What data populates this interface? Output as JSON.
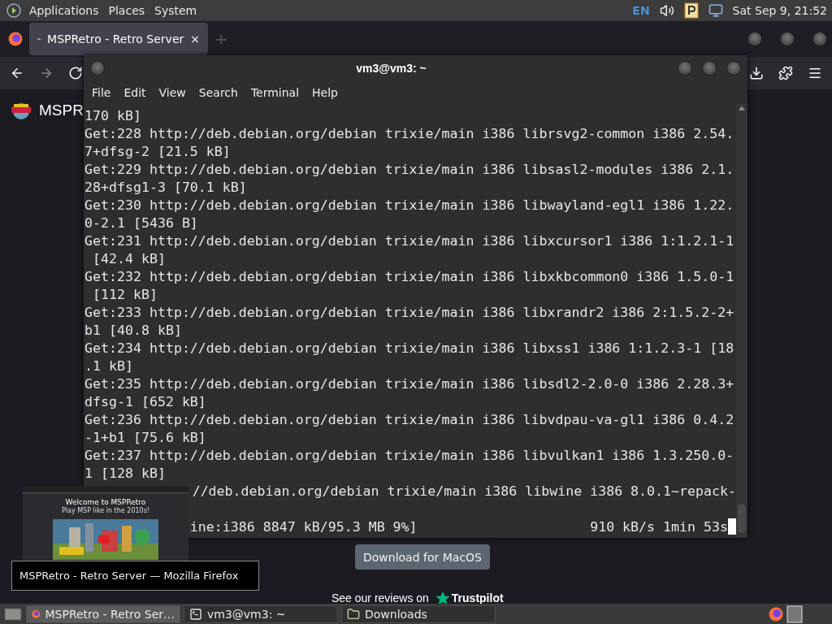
{
  "top_panel": {
    "menus": [
      "Applications",
      "Places",
      "System"
    ],
    "keyboard_layout": "EN",
    "clock": "Sat Sep 9, 21:52"
  },
  "browser": {
    "tab": {
      "title": "MSPRetro - Retro Server",
      "close": "×",
      "selected": true
    },
    "new_tab": "+",
    "site_name": "MSPR",
    "download_button": "Download for MacOS",
    "reviews_text": "See our reviews on",
    "reviews_brand": "Trustpilot"
  },
  "terminal": {
    "title": "vm3@vm3: ~",
    "menu": [
      "File",
      "Edit",
      "View",
      "Search",
      "Terminal",
      "Help"
    ],
    "lines": [
      {
        "kind": "full",
        "text": "170 kB]"
      },
      {
        "kind": "full",
        "text": "Get:228 http://deb.debian.org/debian trixie/main i386 librsvg2-common i386 2.54."
      },
      {
        "kind": "full",
        "text": "7+dfsg-2 [21.5 kB]"
      },
      {
        "kind": "full",
        "text": "Get:229 http://deb.debian.org/debian trixie/main i386 libsasl2-modules i386 2.1."
      },
      {
        "kind": "full",
        "text": "28+dfsg1-3 [70.1 kB]"
      },
      {
        "kind": "full",
        "text": "Get:230 http://deb.debian.org/debian trixie/main i386 libwayland-egl1 i386 1.22."
      },
      {
        "kind": "full",
        "text": "0-2.1 [5436 B]"
      },
      {
        "kind": "full",
        "text": "Get:231 http://deb.debian.org/debian trixie/main i386 libxcursor1 i386 1:1.2.1-1"
      },
      {
        "kind": "full",
        "text": " [42.4 kB]"
      },
      {
        "kind": "full",
        "text": "Get:232 http://deb.debian.org/debian trixie/main i386 libxkbcommon0 i386 1.5.0-1"
      },
      {
        "kind": "full",
        "text": " [112 kB]"
      },
      {
        "kind": "full",
        "text": "Get:233 http://deb.debian.org/debian trixie/main i386 libxrandr2 i386 2:1.5.2-2+"
      },
      {
        "kind": "full",
        "text": "b1 [40.8 kB]"
      },
      {
        "kind": "full",
        "text": "Get:234 http://deb.debian.org/debian trixie/main i386 libxss1 i386 1:1.2.3-1 [18"
      },
      {
        "kind": "full",
        "text": ".1 kB]"
      },
      {
        "kind": "full",
        "text": "Get:235 http://deb.debian.org/debian trixie/main i386 libsdl2-2.0-0 i386 2.28.3+"
      },
      {
        "kind": "full",
        "text": "dfsg-1 [652 kB]"
      },
      {
        "kind": "full",
        "text": "Get:236 http://deb.debian.org/debian trixie/main i386 libvdpau-va-gl1 i386 0.4.2"
      },
      {
        "kind": "full",
        "text": "-1+b1 [75.6 kB]"
      },
      {
        "kind": "full",
        "text": "Get:237 http://deb.debian.org/debian trixie/main i386 libvulkan1 i386 1.3.250.0-"
      },
      {
        "kind": "full",
        "text": "1 [128 kB]"
      },
      {
        "kind": "covered",
        "text": "//deb.debian.org/debian trixie/main i386 libwine i386 8.0.1~repack-"
      },
      {
        "kind": "blank"
      },
      {
        "kind": "status",
        "text": "ine:i386 8847 kB/95.3 MB 9%]",
        "right": "910 kB/s 1min 53s"
      }
    ]
  },
  "preview": {
    "heading": "Welcome to MSPRetro",
    "subheading": "Play MSP like in the 2010s!",
    "tooltip": "MSPRetro - Retro Server — Mozilla Firefox"
  },
  "taskbar": {
    "items": [
      {
        "label": "MSPRetro - Retro Ser…",
        "kind": "browser",
        "selected": true
      },
      {
        "label": "vm3@vm3: ~",
        "kind": "terminal",
        "selected": false
      },
      {
        "label": "Downloads",
        "kind": "folder",
        "selected": false
      }
    ]
  }
}
